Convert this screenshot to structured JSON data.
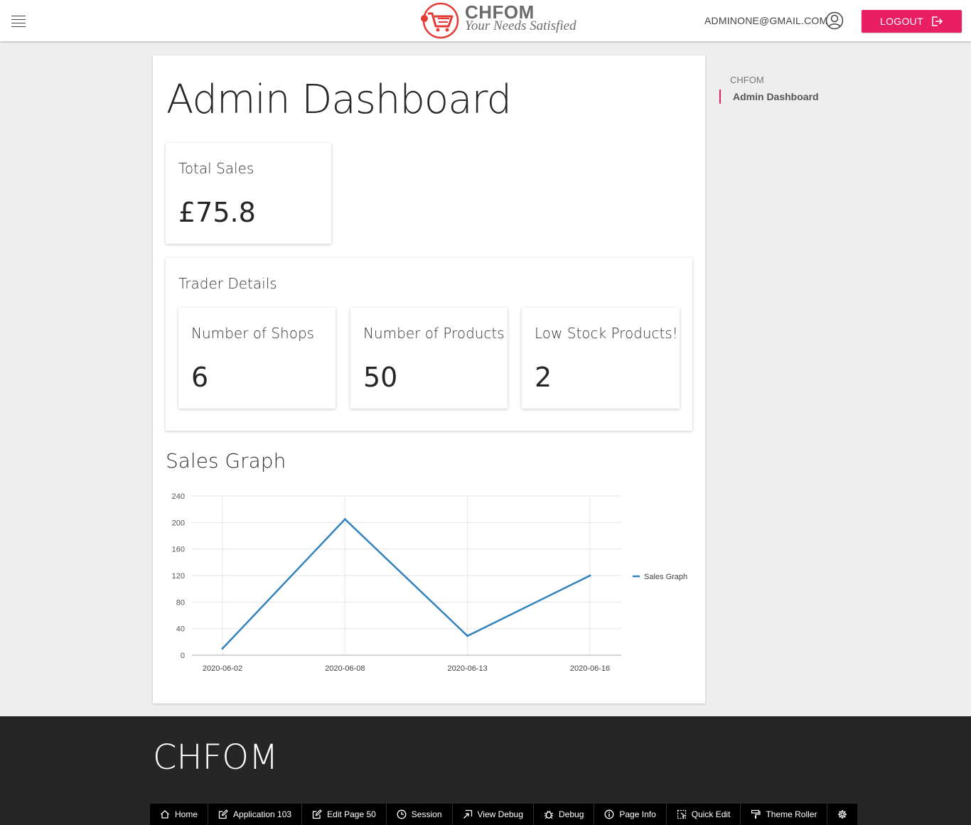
{
  "header": {
    "logo_title": "CHFOM",
    "logo_tagline": "Your Needs Satisfied",
    "user_email": "ADMINONE@GMAIL.COM",
    "logout_label": "LOGOUT"
  },
  "main": {
    "title": "Admin Dashboard",
    "total_sales": {
      "label": "Total Sales",
      "value": "£75.8"
    },
    "trader_details": {
      "title": "Trader Details",
      "cards": [
        {
          "label": "Number of Shops",
          "value": "6"
        },
        {
          "label": "Number of Products",
          "value": "50"
        },
        {
          "label": "Low Stock Products!",
          "value": "2"
        }
      ]
    },
    "graph_title": "Sales Graph"
  },
  "breadcrumb": {
    "parent": "CHFOM",
    "current": "Admin Dashboard"
  },
  "chart_data": {
    "type": "line",
    "categories": [
      "2020-06-02",
      "2020-06-08",
      "2020-06-13",
      "2020-06-16"
    ],
    "series": [
      {
        "name": "Sales Graph",
        "values": [
          10,
          205,
          29,
          120
        ],
        "color": "#3182bd"
      }
    ],
    "yticks": [
      "0",
      "40",
      "80",
      "120",
      "160",
      "200",
      "240"
    ],
    "ylim": [
      0,
      240
    ],
    "grid": true,
    "legend": "right"
  },
  "footer": {
    "title": "CHFOM",
    "toolbar": [
      {
        "label": "Home",
        "icon": "home-icon"
      },
      {
        "label": "Application 103",
        "icon": "edit-icon"
      },
      {
        "label": "Edit Page 50",
        "icon": "edit-icon"
      },
      {
        "label": "Session",
        "icon": "clock-icon"
      },
      {
        "label": "View Debug",
        "icon": "view-debug-icon"
      },
      {
        "label": "Debug",
        "icon": "bug-icon"
      },
      {
        "label": "Page Info",
        "icon": "info-icon"
      },
      {
        "label": "Quick Edit",
        "icon": "quick-edit-icon"
      },
      {
        "label": "Theme Roller",
        "icon": "paint-roller-icon"
      },
      {
        "label": "",
        "icon": "gear-icon"
      }
    ]
  }
}
